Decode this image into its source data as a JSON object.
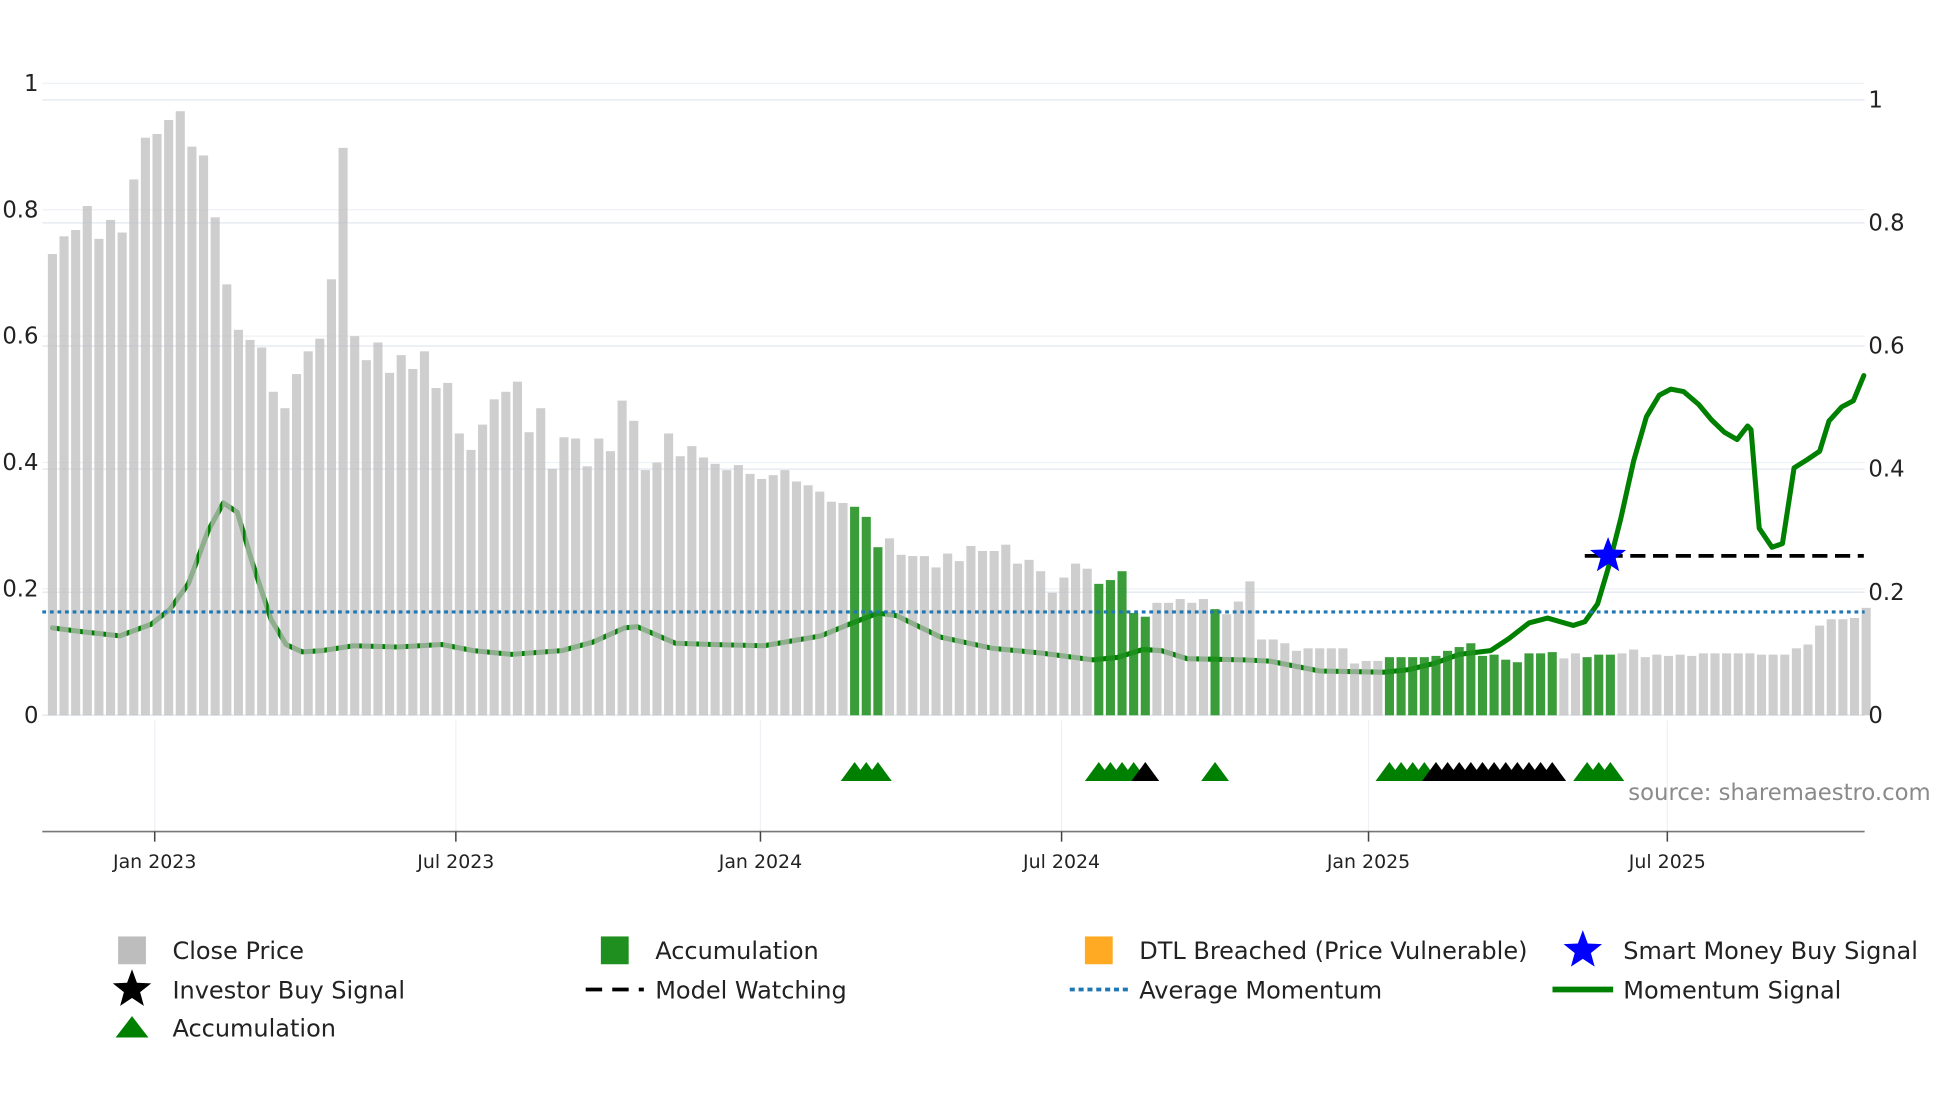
{
  "chart_data": {
    "type": "bar",
    "title": "",
    "source": "source: sharemaestro.com",
    "colors": {
      "close_price": "#bdbdbd",
      "accumulation_bar": "#1f8f1f",
      "dtl_breached": "#ffaa22",
      "smart_money": "#0000ff",
      "investor_buy": "#000000",
      "model_watching": "#000000",
      "average_momentum": "#1f77b4",
      "momentum": "#008000",
      "accumulation_marker": "#008000"
    },
    "left_axis": {
      "ylim": [
        0,
        1
      ],
      "ticks": [
        0,
        0.2,
        0.4,
        0.6,
        0.8,
        1
      ],
      "tick_labels": [
        "0",
        "0.2",
        "0.4",
        "0.6",
        "0.8",
        "1"
      ]
    },
    "right_axis": {
      "ylim": [
        0,
        1
      ],
      "ticks": [
        0,
        0.2,
        0.4,
        0.6,
        0.8,
        1
      ],
      "tick_labels": [
        "0",
        "0.2",
        "0.4",
        "0.6",
        "0.8",
        "1"
      ]
    },
    "x_ticks": [
      {
        "x": 8.8,
        "label": "Jan 2023"
      },
      {
        "x": 34.7,
        "label": "Jul 2023"
      },
      {
        "x": 60.9,
        "label": "Jan 2024"
      },
      {
        "x": 86.8,
        "label": "Jul 2024"
      },
      {
        "x": 113.2,
        "label": "Jan 2025"
      },
      {
        "x": 138.9,
        "label": "Jul 2025"
      }
    ],
    "close_price": [
      0.73,
      0.758,
      0.768,
      0.806,
      0.754,
      0.784,
      0.764,
      0.848,
      0.914,
      0.92,
      0.942,
      0.956,
      0.9,
      0.886,
      0.788,
      0.682,
      0.61,
      0.594,
      0.582,
      0.512,
      0.486,
      0.54,
      0.576,
      0.596,
      0.69,
      0.898,
      0.6,
      0.562,
      0.59,
      0.542,
      0.57,
      0.548,
      0.576,
      0.518,
      0.526,
      0.446,
      0.42,
      0.46,
      0.5,
      0.512,
      0.528,
      0.448,
      0.486,
      0.39,
      0.44,
      0.438,
      0.394,
      0.438,
      0.418,
      0.498,
      0.466,
      0.388,
      0.4,
      0.446,
      0.41,
      0.426,
      0.408,
      0.398,
      0.388,
      0.396,
      0.382,
      0.374,
      0.38,
      0.388,
      0.37,
      0.364,
      0.354,
      0.338,
      0.336,
      0.33,
      0.314,
      0.266,
      0.28,
      0.254,
      0.252,
      0.252,
      0.234,
      0.256,
      0.244,
      0.268,
      0.26,
      0.26,
      0.27,
      0.24,
      0.246,
      0.228,
      0.194,
      0.218,
      0.24,
      0.232,
      0.208,
      0.214,
      0.228,
      0.162,
      0.156,
      0.178,
      0.178,
      0.184,
      0.178,
      0.184,
      0.168,
      0.16,
      0.18,
      0.212,
      0.12,
      0.12,
      0.114,
      0.102,
      0.106,
      0.106,
      0.106,
      0.106,
      0.082,
      0.086,
      0.086,
      0.092,
      0.092,
      0.092,
      0.092,
      0.094,
      0.102,
      0.108,
      0.114,
      0.094,
      0.096,
      0.088,
      0.084,
      0.098,
      0.098,
      0.1,
      0.09,
      0.098,
      0.092,
      0.096,
      0.096,
      0.098,
      0.104,
      0.092,
      0.096,
      0.094,
      0.096,
      0.094,
      0.098,
      0.098,
      0.098,
      0.098,
      0.098,
      0.096,
      0.096,
      0.096,
      0.106,
      0.112,
      0.142,
      0.152,
      0.152,
      0.154,
      0.17
    ],
    "accumulation_indices": [
      69,
      70,
      71,
      90,
      91,
      92,
      93,
      94,
      100,
      115,
      116,
      117,
      118,
      119,
      120,
      121,
      122,
      123,
      124,
      125,
      126,
      127,
      128,
      129,
      132,
      133,
      134
    ],
    "investor_buy_indices": [
      94,
      119,
      120,
      121,
      122,
      123,
      124,
      125,
      126,
      127,
      128,
      129
    ],
    "momentum_signal": [
      [
        0,
        0.142
      ],
      [
        2.5,
        0.136
      ],
      [
        5.8,
        0.129
      ],
      [
        8.5,
        0.148
      ],
      [
        10.1,
        0.172
      ],
      [
        11.7,
        0.214
      ],
      [
        13.4,
        0.3
      ],
      [
        14.7,
        0.345
      ],
      [
        15.9,
        0.33
      ],
      [
        17.2,
        0.248
      ],
      [
        18.8,
        0.156
      ],
      [
        20.1,
        0.115
      ],
      [
        21.5,
        0.103
      ],
      [
        23.2,
        0.105
      ],
      [
        25.9,
        0.113
      ],
      [
        29.7,
        0.111
      ],
      [
        33.5,
        0.115
      ],
      [
        36.2,
        0.105
      ],
      [
        39.5,
        0.099
      ],
      [
        43.8,
        0.105
      ],
      [
        46.5,
        0.119
      ],
      [
        49.2,
        0.142
      ],
      [
        50.3,
        0.144
      ],
      [
        53.6,
        0.117
      ],
      [
        56.8,
        0.115
      ],
      [
        61.2,
        0.113
      ],
      [
        66.1,
        0.129
      ],
      [
        68.8,
        0.15
      ],
      [
        71,
        0.166
      ],
      [
        72.6,
        0.162
      ],
      [
        76.4,
        0.127
      ],
      [
        80.8,
        0.109
      ],
      [
        85.1,
        0.101
      ],
      [
        89.5,
        0.09
      ],
      [
        91.6,
        0.094
      ],
      [
        93.8,
        0.107
      ],
      [
        95.4,
        0.105
      ],
      [
        97.6,
        0.092
      ],
      [
        102.5,
        0.09
      ],
      [
        104.7,
        0.088
      ],
      [
        109,
        0.072
      ],
      [
        114.5,
        0.07
      ],
      [
        116.6,
        0.074
      ],
      [
        118.8,
        0.084
      ],
      [
        121,
        0.099
      ],
      [
        123.7,
        0.105
      ],
      [
        125.3,
        0.125
      ],
      [
        127,
        0.15
      ],
      [
        128.6,
        0.158
      ],
      [
        130.8,
        0.146
      ],
      [
        131.8,
        0.152
      ],
      [
        132.9,
        0.181
      ],
      [
        133.8,
        0.238
      ],
      [
        134.9,
        0.32
      ],
      [
        136,
        0.413
      ],
      [
        137.1,
        0.485
      ],
      [
        138.2,
        0.52
      ],
      [
        139.2,
        0.53
      ],
      [
        140.3,
        0.526
      ],
      [
        141.6,
        0.505
      ],
      [
        142.7,
        0.48
      ],
      [
        143.8,
        0.46
      ],
      [
        144.9,
        0.448
      ],
      [
        145.8,
        0.47
      ],
      [
        146.1,
        0.464
      ],
      [
        146.8,
        0.304
      ],
      [
        147.9,
        0.273
      ],
      [
        148.8,
        0.279
      ],
      [
        149.8,
        0.402
      ],
      [
        150.9,
        0.415
      ],
      [
        152,
        0.429
      ],
      [
        152.8,
        0.478
      ],
      [
        153.9,
        0.501
      ],
      [
        154.9,
        0.511
      ],
      [
        155.8,
        0.552
      ]
    ],
    "average_momentum": 0.168,
    "model_watching": {
      "from": 131.8,
      "to": 155.8,
      "value": 0.259
    },
    "smart_money_buy": {
      "x": 133.8,
      "value": 0.259
    },
    "legend_placement": "bottom",
    "legend": [
      {
        "label": "Close Price",
        "marker": "square",
        "color_key": "close_price"
      },
      {
        "label": "Accumulation",
        "marker": "square",
        "color_key": "accumulation_bar"
      },
      {
        "label": "DTL Breached (Price Vulnerable)",
        "marker": "square",
        "color_key": "dtl_breached"
      },
      {
        "label": "Smart Money Buy Signal",
        "marker": "star",
        "color_key": "smart_money"
      },
      {
        "label": "Investor Buy Signal",
        "marker": "star",
        "color_key": "investor_buy"
      },
      {
        "label": "Model Watching",
        "marker": "dash",
        "color_key": "model_watching"
      },
      {
        "label": "Average Momentum",
        "marker": "dot",
        "color_key": "average_momentum"
      },
      {
        "label": "Momentum Signal",
        "marker": "line",
        "color_key": "momentum"
      },
      {
        "label": "Accumulation",
        "marker": "triangle",
        "color_key": "accumulation_marker"
      }
    ]
  }
}
